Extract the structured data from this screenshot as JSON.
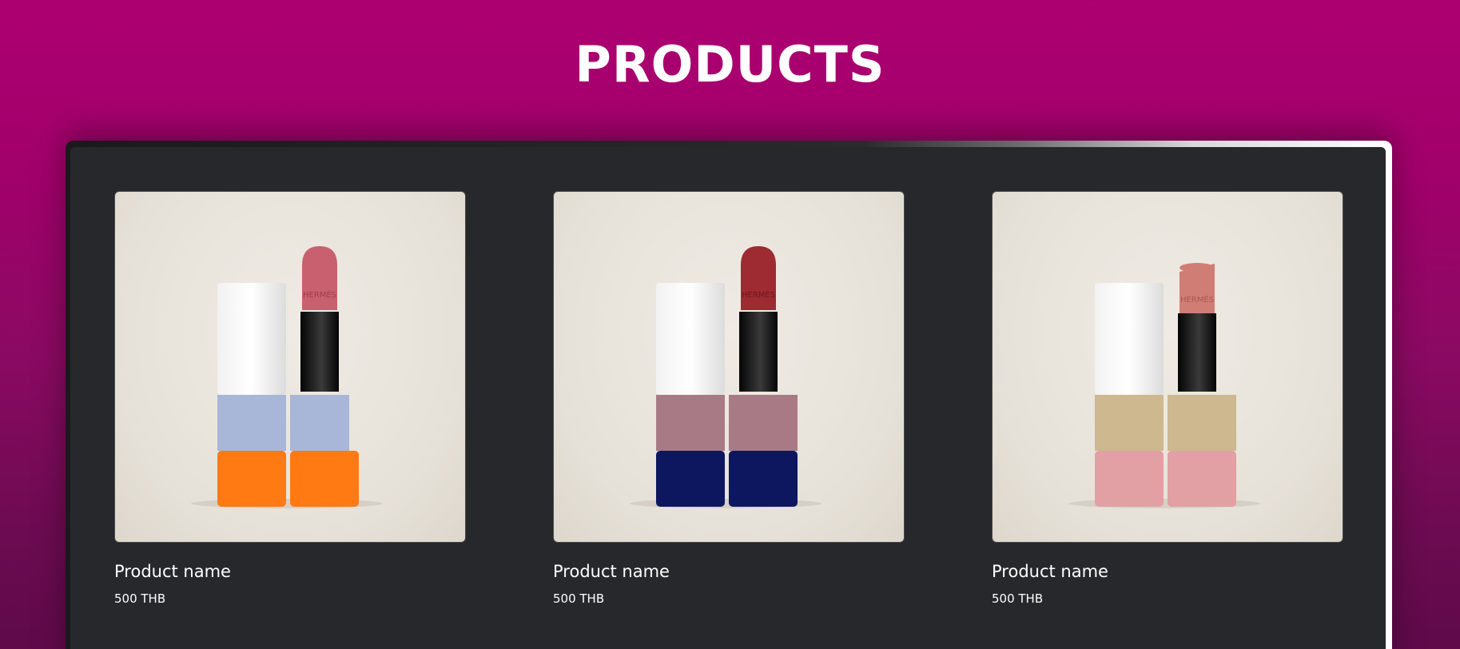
{
  "header": {
    "title": "PRODUCTS"
  },
  "products": [
    {
      "name": "Product name",
      "price": "500 THB",
      "image": {
        "brand_engraving": "HERMÈS",
        "bullet_color": "#c9606f",
        "band_color": "#a8b6d8",
        "base_color": "#ff7a12"
      }
    },
    {
      "name": "Product name",
      "price": "500 THB",
      "image": {
        "brand_engraving": "HERMÈS",
        "bullet_color": "#9e2a32",
        "band_color": "#a87a86",
        "base_color": "#0d1760"
      }
    },
    {
      "name": "Product name",
      "price": "500 THB",
      "image": {
        "brand_engraving": "HERMÈS",
        "bullet_color": "#cf7d75",
        "band_color": "#cdb88f",
        "base_color": "#e2a0a4"
      }
    }
  ]
}
